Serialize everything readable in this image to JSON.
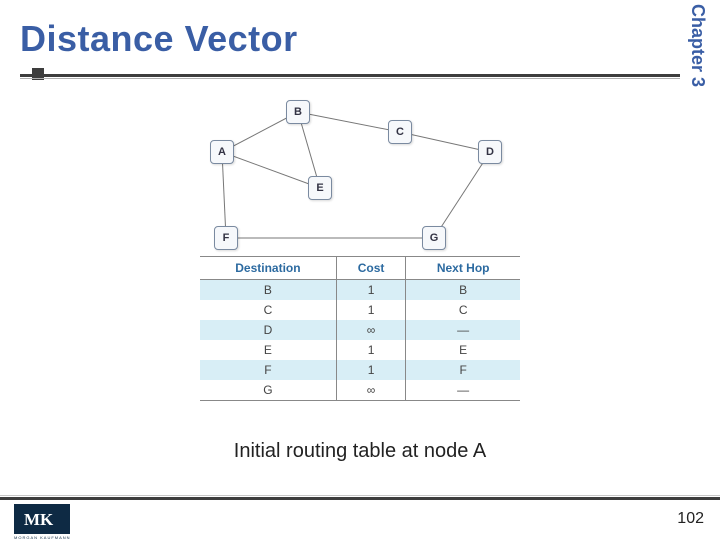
{
  "chapter_label": "Chapter 3",
  "title": "Distance Vector",
  "graph": {
    "nodes": {
      "A": "A",
      "B": "B",
      "C": "C",
      "D": "D",
      "E": "E",
      "F": "F",
      "G": "G"
    },
    "edges": [
      [
        "A",
        "B"
      ],
      [
        "A",
        "E"
      ],
      [
        "A",
        "F"
      ],
      [
        "B",
        "C"
      ],
      [
        "C",
        "D"
      ],
      [
        "D",
        "G"
      ],
      [
        "E",
        "B"
      ],
      [
        "F",
        "G"
      ]
    ]
  },
  "table_headers": {
    "dest": "Destination",
    "cost": "Cost",
    "hop": "Next Hop"
  },
  "table_rows": [
    {
      "dest": "B",
      "cost": "1",
      "hop": "B"
    },
    {
      "dest": "C",
      "cost": "1",
      "hop": "C"
    },
    {
      "dest": "D",
      "cost": "∞",
      "hop": "—"
    },
    {
      "dest": "E",
      "cost": "1",
      "hop": "E"
    },
    {
      "dest": "F",
      "cost": "1",
      "hop": "F"
    },
    {
      "dest": "G",
      "cost": "∞",
      "hop": "—"
    }
  ],
  "caption": "Initial routing table at node A",
  "page_number": "102",
  "logo_text": "MK",
  "publisher": "MORGAN KAUFMANN",
  "chart_data": {
    "type": "table",
    "title": "Initial routing table at node A",
    "columns": [
      "Destination",
      "Cost",
      "Next Hop"
    ],
    "rows": [
      [
        "B",
        "1",
        "B"
      ],
      [
        "C",
        "1",
        "C"
      ],
      [
        "D",
        "∞",
        "—"
      ],
      [
        "E",
        "1",
        "E"
      ],
      [
        "F",
        "1",
        "F"
      ],
      [
        "G",
        "∞",
        "—"
      ]
    ]
  }
}
